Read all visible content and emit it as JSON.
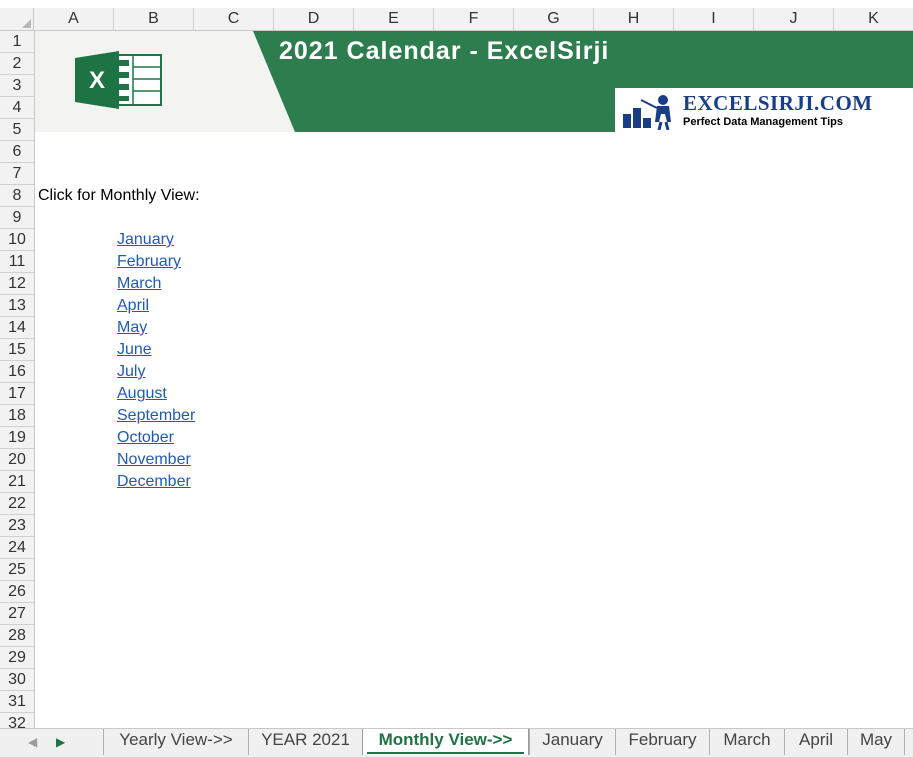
{
  "columns": [
    "A",
    "B",
    "C",
    "D",
    "E",
    "F",
    "G",
    "H",
    "I",
    "J",
    "K"
  ],
  "rows": [
    "1",
    "2",
    "3",
    "4",
    "5",
    "6",
    "7",
    "8",
    "9",
    "10",
    "11",
    "12",
    "13",
    "14",
    "15",
    "16",
    "17",
    "18",
    "19",
    "20",
    "21",
    "22",
    "23",
    "24",
    "25",
    "26",
    "27",
    "28",
    "29",
    "30",
    "31",
    "32"
  ],
  "banner": {
    "title": "2021 Calendar - ExcelSirji",
    "logo_name": "EXCELSIRJI.COM",
    "logo_tagline": "Perfect Data Management Tips",
    "logo_letter": "X"
  },
  "label": "Click for Monthly View:",
  "months": [
    "January ",
    "February",
    "March",
    "April",
    "May",
    "June",
    "July",
    "August",
    "September",
    "October",
    "November",
    "December"
  ],
  "tabs": [
    {
      "label": "Yearly View->>",
      "active": false
    },
    {
      "label": "YEAR 2021",
      "active": false
    },
    {
      "label": "Monthly View->>",
      "active": true
    },
    {
      "label": "January",
      "active": false
    },
    {
      "label": "February",
      "active": false
    },
    {
      "label": "March",
      "active": false
    },
    {
      "label": "April",
      "active": false
    },
    {
      "label": "May",
      "active": false
    }
  ],
  "colors": {
    "banner_green": "#2e7d4f",
    "link": "#1f5bb5",
    "active_tab": "#217346"
  }
}
